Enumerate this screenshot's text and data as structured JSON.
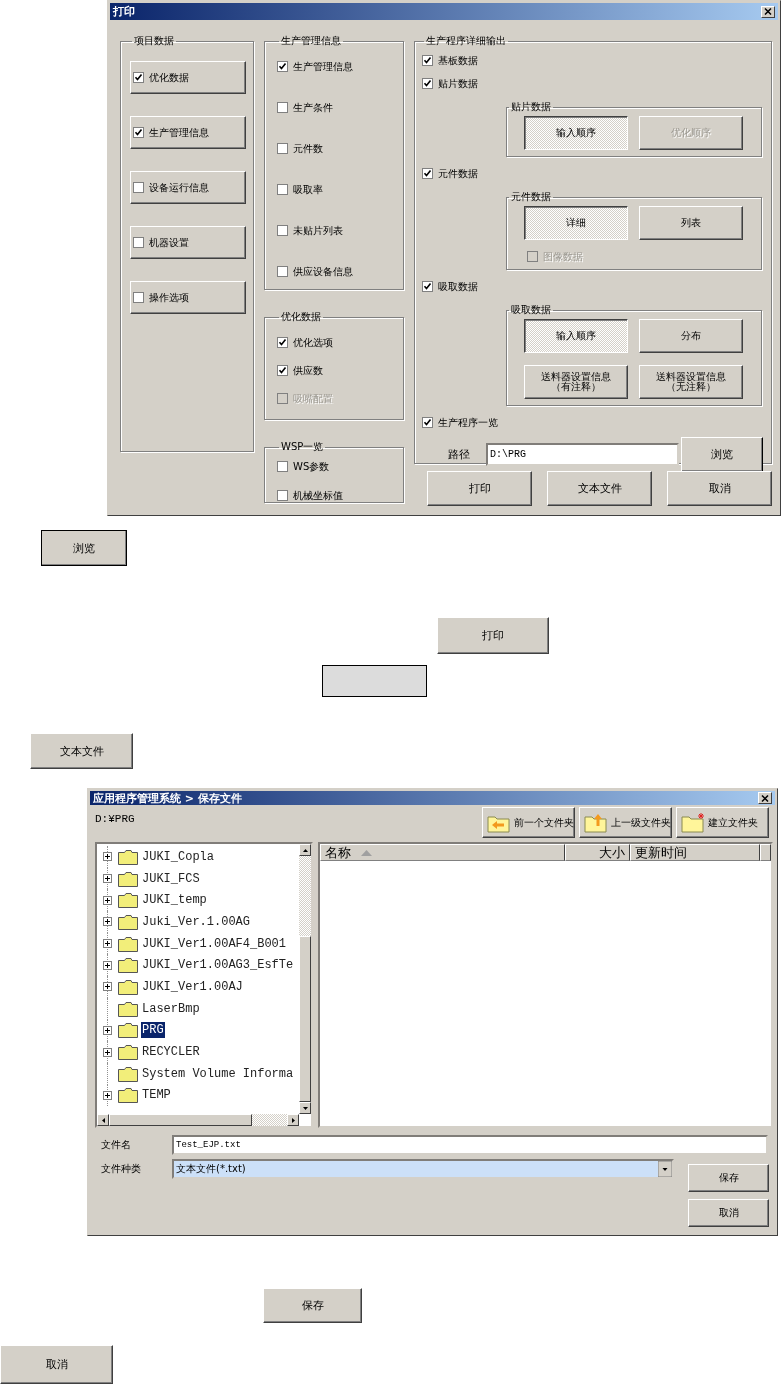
{
  "print_dialog": {
    "title": "打印",
    "item_data": {
      "title": "项目数据",
      "items": [
        {
          "label": "优化数据",
          "checked": true
        },
        {
          "label": "生产管理信息",
          "checked": true
        },
        {
          "label": "设备运行信息",
          "checked": false
        },
        {
          "label": "机器设置",
          "checked": false
        },
        {
          "label": "操作选项",
          "checked": false
        }
      ]
    },
    "production_info": {
      "title": "生产管理信息",
      "items": [
        {
          "label": "生产管理信息",
          "checked": true
        },
        {
          "label": "生产条件",
          "checked": false
        },
        {
          "label": "元件数",
          "checked": false
        },
        {
          "label": "吸取率",
          "checked": false
        },
        {
          "label": "未贴片列表",
          "checked": false
        },
        {
          "label": "供应设备信息",
          "checked": false
        }
      ]
    },
    "optimization_data": {
      "title": "优化数据",
      "items": [
        {
          "label": "优化选项",
          "checked": true,
          "disabled": false
        },
        {
          "label": "供应数",
          "checked": true,
          "disabled": false
        },
        {
          "label": "吸嘴配置",
          "checked": false,
          "disabled": true
        }
      ]
    },
    "wsp_list": {
      "title": "WSP一览",
      "items": [
        {
          "label": "WS参数",
          "checked": false
        },
        {
          "label": "机械坐标值",
          "checked": false
        }
      ]
    },
    "detail_output": {
      "title": "生产程序详细输出",
      "sections": [
        {
          "label": "基板数据",
          "checked": true
        },
        {
          "label": "贴片数据",
          "checked": true,
          "group": {
            "title": "贴片数据",
            "buttons": [
              {
                "label": "输入顺序",
                "selected": true,
                "disabled": false
              },
              {
                "label": "优化顺序",
                "selected": false,
                "disabled": true
              }
            ]
          }
        },
        {
          "label": "元件数据",
          "checked": true,
          "group": {
            "title": "元件数据",
            "buttons": [
              {
                "label": "详细",
                "selected": true,
                "disabled": false
              },
              {
                "label": "列表",
                "selected": false,
                "disabled": false
              }
            ],
            "option": {
              "label": "图像数据",
              "checked": false,
              "disabled": true
            }
          }
        },
        {
          "label": "吸取数据",
          "checked": true,
          "group": {
            "title": "吸取数据",
            "buttons": [
              {
                "label": "输入顺序",
                "selected": true,
                "disabled": false
              },
              {
                "label": "分布",
                "selected": false,
                "disabled": false
              },
              {
                "label": "送料器设置信息（有注释）",
                "selected": false,
                "disabled": false
              },
              {
                "label": "送料器设置信息（无注释）",
                "selected": false,
                "disabled": false
              }
            ]
          }
        },
        {
          "label": "生产程序一览",
          "checked": true
        }
      ],
      "path_label": "路径",
      "path_value": "D:\\PRG",
      "browse_button": "浏览"
    },
    "buttons": [
      "打印",
      "文本文件",
      "取消"
    ]
  },
  "loose_buttons": [
    {
      "kind": "button",
      "label": "浏览"
    },
    {
      "kind": "button",
      "label": "打印"
    },
    {
      "kind": "blank"
    },
    {
      "kind": "button",
      "label": "文本文件"
    }
  ],
  "save_dialog": {
    "title": "应用程序管理系统 > 保存文件",
    "current_path": "D:¥PRG",
    "toolbar": [
      {
        "kind": "back",
        "label": "前一个文件夹"
      },
      {
        "kind": "up",
        "label": "上一级文件夹"
      },
      {
        "kind": "new",
        "label": "建立文件夹"
      }
    ],
    "tree": [
      {
        "label": "JUKI_Copla",
        "expandable": true,
        "selected": false
      },
      {
        "label": "JUKI_FCS",
        "expandable": true,
        "selected": false
      },
      {
        "label": "JUKI_temp",
        "expandable": true,
        "selected": false
      },
      {
        "label": "Juki_Ver.1.00AG",
        "expandable": true,
        "selected": false
      },
      {
        "label": "JUKI_Ver1.00AF4_B001",
        "expandable": true,
        "selected": false
      },
      {
        "label": "JUKI_Ver1.00AG3_EsfTe",
        "expandable": true,
        "selected": false
      },
      {
        "label": "JUKI_Ver1.00AJ",
        "expandable": true,
        "selected": false
      },
      {
        "label": "LaserBmp",
        "expandable": false,
        "selected": false
      },
      {
        "label": "PRG",
        "expandable": true,
        "selected": true
      },
      {
        "label": "RECYCLER",
        "expandable": true,
        "selected": false
      },
      {
        "label": "System Volume Informa",
        "expandable": false,
        "selected": false
      },
      {
        "label": "TEMP",
        "expandable": true,
        "selected": false
      }
    ],
    "columns": [
      {
        "label": "名称",
        "sorted": true
      },
      {
        "label": "大小",
        "sorted": false
      },
      {
        "label": "更新时间",
        "sorted": false
      }
    ],
    "file_name_label": "文件名",
    "file_name": "Test_EJP.txt",
    "file_type_label": "文件种类",
    "file_type": "文本文件(*.txt)",
    "buttons": [
      "保存",
      "取消"
    ]
  },
  "loose_buttons_after": [
    {
      "kind": "button",
      "label": "保存"
    },
    {
      "kind": "button",
      "label": "取消"
    }
  ]
}
